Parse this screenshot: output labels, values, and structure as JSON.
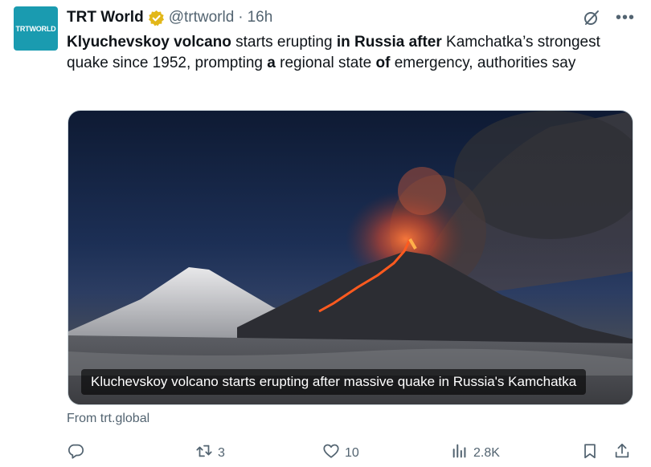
{
  "author": {
    "name": "TRT World",
    "handle": "@trtworld",
    "separator": "·",
    "time": "16h",
    "avatar_text": "TRTWORLD"
  },
  "tweet": {
    "segments": [
      {
        "text": "Klyuchevskoy volcano",
        "bold": true
      },
      {
        "text": " starts erupting ",
        "bold": false
      },
      {
        "text": "in Russia after",
        "bold": true
      },
      {
        "text": " Kamchatka’s strongest quake since 1952, prompting ",
        "bold": false
      },
      {
        "text": "a",
        "bold": true
      },
      {
        "text": " regional state ",
        "bold": false
      },
      {
        "text": "of",
        "bold": true
      },
      {
        "text": " emergency, authorities say",
        "bold": false
      }
    ]
  },
  "media": {
    "caption": "Kluchevskoy volcano starts erupting after massive quake in Russia's Kamchatka",
    "source": "From trt.global"
  },
  "actions": {
    "reply": {
      "icon": "reply-icon",
      "count": ""
    },
    "retweet": {
      "icon": "retweet-icon",
      "count": "3"
    },
    "like": {
      "icon": "heart-icon",
      "count": "10"
    },
    "views": {
      "icon": "views-icon",
      "count": "2.8K"
    },
    "bookmark": {
      "icon": "bookmark-icon"
    },
    "share": {
      "icon": "share-icon"
    }
  },
  "colors": {
    "text_primary": "#0f1419",
    "text_secondary": "#536471",
    "verified_gold": "#e2b719",
    "avatar_bg": "#1a9bb0"
  }
}
